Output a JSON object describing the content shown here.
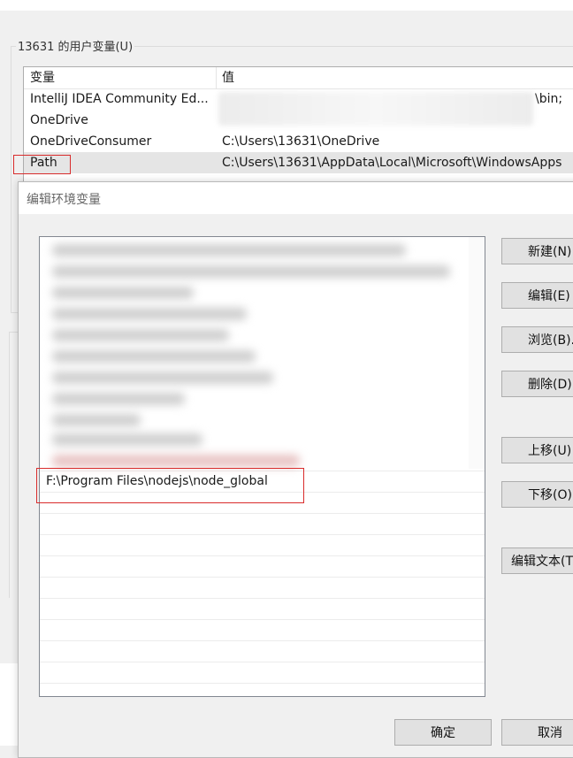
{
  "user_vars": {
    "group_label": "13631 的用户变量(U)",
    "col_variable": "变量",
    "col_value": "值",
    "rows": [
      {
        "name": "IntelliJ IDEA Community Ed...",
        "value": "\\bin;"
      },
      {
        "name": "OneDrive",
        "value": ""
      },
      {
        "name": "OneDriveConsumer",
        "value": "C:\\Users\\13631\\OneDrive"
      },
      {
        "name": "Path",
        "value": "C:\\Users\\13631\\AppData\\Local\\Microsoft\\WindowsApps"
      }
    ]
  },
  "dialog": {
    "title": "编辑环境变量",
    "new_entry": "F:\\Program Files\\nodejs\\node_global",
    "buttons": {
      "new": "新建(N)",
      "edit": "编辑(E)",
      "browse": "浏览(B)...",
      "delete": "删除(D)",
      "move_up": "上移(U)",
      "move_down": "下移(O)",
      "edit_text": "编辑文本(T)...",
      "ok": "确定",
      "cancel": "取消"
    }
  },
  "colors": {
    "highlight_red": "#d92c2c",
    "selected_row": "#e5e5e5",
    "button_face": "#e1e1e1"
  }
}
